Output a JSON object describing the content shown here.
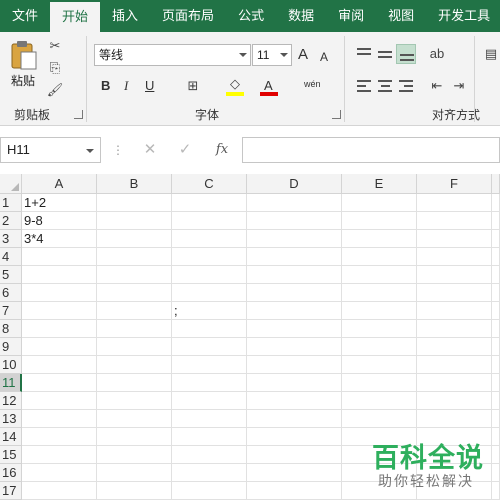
{
  "tabs": [
    {
      "label": "文件",
      "active": false
    },
    {
      "label": "开始",
      "active": true
    },
    {
      "label": "插入",
      "active": false
    },
    {
      "label": "页面布局",
      "active": false
    },
    {
      "label": "公式",
      "active": false
    },
    {
      "label": "数据",
      "active": false
    },
    {
      "label": "审阅",
      "active": false
    },
    {
      "label": "视图",
      "active": false
    },
    {
      "label": "开发工具",
      "active": false
    }
  ],
  "ribbon": {
    "clipboard": {
      "paste_label": "粘贴",
      "group_label": "剪贴板"
    },
    "font": {
      "font_name": "等线",
      "font_size": "11",
      "grow_label": "A",
      "shrink_label": "A",
      "bold_label": "B",
      "italic_label": "I",
      "underline_label": "U",
      "phonetic_label": "wén",
      "group_label": "字体",
      "fill_color": "#ffff00",
      "font_color": "#e00000"
    },
    "alignment": {
      "group_label": "对齐方式"
    }
  },
  "formula_bar": {
    "name_box": "H11",
    "cancel_glyph": "✕",
    "enter_glyph": "✓",
    "fx_label": "fx",
    "value": ""
  },
  "sheet": {
    "columns": [
      "A",
      "B",
      "C",
      "D",
      "E",
      "F"
    ],
    "rows": [
      "1",
      "2",
      "3",
      "4",
      "5",
      "6",
      "7",
      "8",
      "9",
      "10",
      "11",
      "12",
      "13",
      "14",
      "15",
      "16",
      "17"
    ],
    "active_row": "11",
    "cells": {
      "A1": "1+2",
      "A2": "9-8",
      "A3": "3*4",
      "C7": ";"
    }
  },
  "watermark": {
    "title": "百科全说",
    "subtitle": "助你轻松解决"
  },
  "colors": {
    "accent": "#217346",
    "watermark_green": "#2eaf5d"
  }
}
